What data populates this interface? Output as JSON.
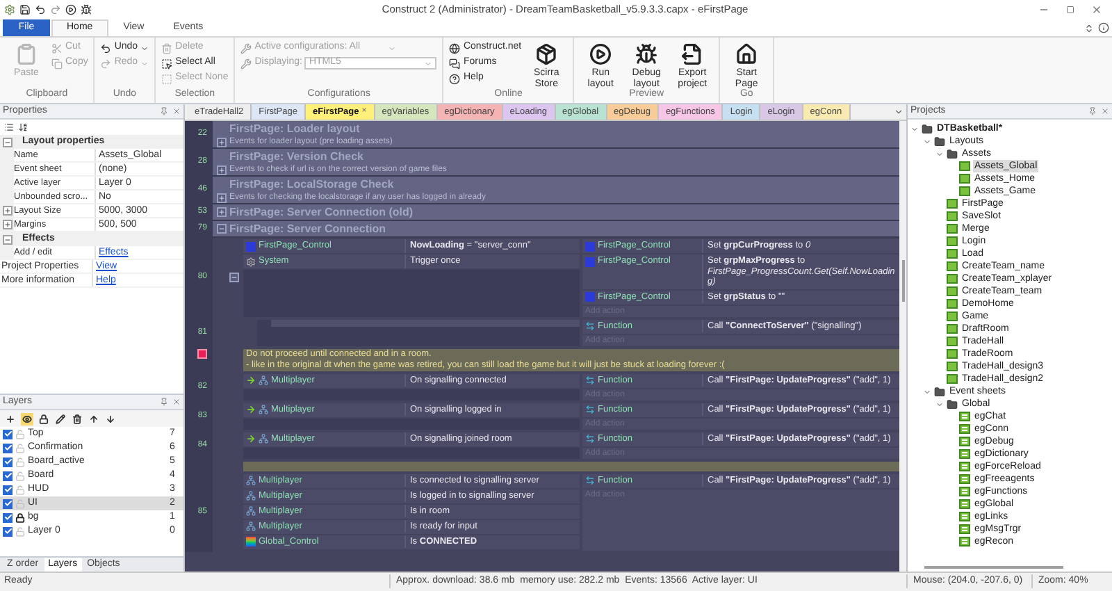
{
  "title_bar": {
    "title": "Construct 2 (Administrator) - DreamTeamBasketball_v5.9.3.3.capx - eFirstPage"
  },
  "ribbon_tabs": [
    {
      "label": "File",
      "kind": "file",
      "selected": false
    },
    {
      "label": "Home",
      "kind": "tab",
      "selected": true
    },
    {
      "label": "View",
      "kind": "tab",
      "selected": false
    },
    {
      "label": "Events",
      "kind": "tab",
      "selected": false
    }
  ],
  "ribbon_groups": [
    {
      "label": "Clipboard",
      "items": [
        {
          "kind": "large",
          "label": "Paste",
          "disabled": true
        },
        {
          "kind": "small",
          "label": "Cut",
          "disabled": true
        },
        {
          "kind": "small",
          "label": "Copy",
          "disabled": true
        }
      ]
    },
    {
      "label": "Undo",
      "items": [
        {
          "kind": "menu",
          "label": "Undo",
          "disabled": false
        },
        {
          "kind": "menu",
          "label": "Redo",
          "disabled": true
        }
      ]
    },
    {
      "label": "Selection",
      "items": [
        {
          "kind": "small",
          "label": "Delete",
          "disabled": true
        },
        {
          "kind": "small",
          "label": "Select All",
          "disabled": false
        },
        {
          "kind": "small",
          "label": "Select None",
          "disabled": true
        }
      ]
    },
    {
      "label": "Configurations",
      "items": [
        {
          "kind": "combo",
          "label": "Active configurations: All",
          "disabled": true
        },
        {
          "kind": "select",
          "label": "Displaying:",
          "value": "HTML5",
          "disabled": true
        }
      ]
    },
    {
      "label": "Online",
      "items": [
        {
          "kind": "small",
          "label": "Construct.net",
          "disabled": false
        },
        {
          "kind": "small",
          "label": "Forums",
          "disabled": false
        },
        {
          "kind": "small",
          "label": "Help",
          "disabled": false
        },
        {
          "kind": "large",
          "label": "Scirra Store",
          "disabled": false
        }
      ]
    },
    {
      "label": "Preview",
      "items": [
        {
          "kind": "large",
          "label": "Run layout",
          "disabled": false
        },
        {
          "kind": "large",
          "label": "Debug layout",
          "disabled": false
        },
        {
          "kind": "large",
          "label": "Export project",
          "disabled": false
        }
      ]
    },
    {
      "label": "Go",
      "items": [
        {
          "kind": "large",
          "label": "Start Page",
          "disabled": false
        }
      ]
    }
  ],
  "properties": {
    "title": "Properties",
    "sections": [
      {
        "title": "Layout properties",
        "expanded": true,
        "rows": [
          {
            "name": "Name",
            "value": "Assets_Global",
            "expandable": false,
            "link": false
          },
          {
            "name": "Event sheet",
            "value": "(none)",
            "expandable": false,
            "link": false
          },
          {
            "name": "Active layer",
            "value": "Layer 0",
            "expandable": false,
            "link": false
          },
          {
            "name": "Unbounded scro...",
            "value": "No",
            "expandable": false,
            "link": false
          },
          {
            "name": "Layout Size",
            "value": "5000, 3000",
            "expandable": true,
            "link": false
          },
          {
            "name": "Margins",
            "value": "500, 500",
            "expandable": true,
            "link": false
          }
        ]
      },
      {
        "title": "Effects",
        "expanded": true,
        "rows": [
          {
            "name": "Add / edit",
            "value": "Effects",
            "expandable": false,
            "link": true
          }
        ]
      }
    ],
    "rows": [
      {
        "name": "Project Properties",
        "value": "View",
        "link": true
      },
      {
        "name": "More information",
        "value": "Help",
        "link": true
      }
    ]
  },
  "layers": {
    "title": "Layers",
    "eye_tool_on": true,
    "items": [
      {
        "name": "Top",
        "number": "7",
        "visible": true,
        "locked": false,
        "selected": false
      },
      {
        "name": "Confirmation",
        "number": "6",
        "visible": true,
        "locked": false,
        "selected": false
      },
      {
        "name": "Board_active",
        "number": "5",
        "visible": true,
        "locked": false,
        "selected": false
      },
      {
        "name": "Board",
        "number": "4",
        "visible": true,
        "locked": false,
        "selected": false
      },
      {
        "name": "HUD",
        "number": "3",
        "visible": true,
        "locked": false,
        "selected": false
      },
      {
        "name": "UI",
        "number": "2",
        "visible": true,
        "locked": false,
        "selected": true
      },
      {
        "name": "bg",
        "number": "1",
        "visible": true,
        "locked": true,
        "selected": false
      },
      {
        "name": "Layer 0",
        "number": "0",
        "visible": true,
        "locked": false,
        "selected": false
      }
    ],
    "tabs": [
      {
        "label": "Z order",
        "selected": false
      },
      {
        "label": "Layers",
        "selected": true
      },
      {
        "label": "Objects",
        "selected": false
      }
    ]
  },
  "sheet_tabs": [
    {
      "label": "eTradeHall2",
      "color": "#eeeeee",
      "selected": false
    },
    {
      "label": "FirstPage",
      "color": "#dde6f4",
      "selected": false
    },
    {
      "label": "eFirstPage",
      "color": "#fff07a",
      "selected": true,
      "close": "×"
    },
    {
      "label": "egVariables",
      "color": "#d6e6bc",
      "selected": false
    },
    {
      "label": "egDictionary",
      "color": "#f4b4b4",
      "selected": false
    },
    {
      "label": "eLoading",
      "color": "#dcc6f0",
      "selected": false
    },
    {
      "label": "egGlobal",
      "color": "#b8e2d2",
      "selected": false
    },
    {
      "label": "egDebug",
      "color": "#f8cc98",
      "selected": false
    },
    {
      "label": "egFunctions",
      "color": "#f6c6e6",
      "selected": false
    },
    {
      "label": "Login",
      "color": "#c6e0f2",
      "selected": false
    },
    {
      "label": "eLogin",
      "color": "#d8c8e6",
      "selected": false
    },
    {
      "label": "egConn",
      "color": "#f8eab0",
      "selected": false
    }
  ],
  "events": [
    {
      "kind": "group",
      "number": "22",
      "title": "FirstPage: Loader layout",
      "description": "Events for loader layout (pre loading assets)",
      "expanded": false
    },
    {
      "kind": "group",
      "number": "28",
      "title": "FirstPage: Version Check",
      "description": "Events to check if url is on the correct version of game files",
      "expanded": false
    },
    {
      "kind": "group",
      "number": "46",
      "title": "FirstPage: LocalStorage Check",
      "description": "Events for checking the localstorage if any user has logged in already",
      "expanded": false
    },
    {
      "kind": "group",
      "number": "53",
      "title": "FirstPage: Server Connection (old)",
      "expanded": false
    },
    {
      "kind": "group",
      "number": "79",
      "title": "FirstPage: Server Connection",
      "expanded": true,
      "children": [
        {
          "kind": "event",
          "number": "80",
          "trigger": false,
          "expanded": true,
          "conditions": [
            {
              "kind": "sprite",
              "object": "FirstPage_Control",
              "text": "**NowLoading** = \"server_conn\""
            },
            {
              "kind": "system",
              "object": "System",
              "text": "Trigger once"
            }
          ],
          "actions": [
            {
              "kind": "sprite",
              "object": "FirstPage_Control",
              "text": "Set **grpCurProgress** to *0*"
            },
            {
              "kind": "sprite",
              "object": "FirstPage_Control",
              "text": "Set **grpMaxProgress** to *FirstPage_ProgressCount.Get(Self.NowLoading)*"
            },
            {
              "kind": "sprite",
              "object": "FirstPage_Control",
              "text": "Set **grpStatus** to \"\""
            }
          ],
          "add_action": "Add action",
          "children": [
            {
              "kind": "event",
              "number": "81",
              "actions": [
                {
                  "kind": "function",
                  "object": "Function",
                  "text": "Call **\"ConnectToServer\"** (\"signalling\")"
                }
              ],
              "add_action": "Add action"
            }
          ]
        },
        {
          "kind": "comment",
          "text": "Do not proceed until connected and in a room.\n- like in the original dt when the game was retired, you can still load the game but it will just be stuck at loading forever :("
        },
        {
          "kind": "event",
          "number": "82",
          "trigger": true,
          "conditions": [
            {
              "kind": "multiplayer",
              "object": "Multiplayer",
              "text": "On signalling connected"
            }
          ],
          "actions": [
            {
              "kind": "function",
              "object": "Function",
              "text": "Call **\"FirstPage: UpdateProgress\"** (\"add\", 1)"
            }
          ],
          "add_action": "Add action"
        },
        {
          "kind": "event",
          "number": "83",
          "trigger": true,
          "conditions": [
            {
              "kind": "multiplayer",
              "object": "Multiplayer",
              "text": "On signalling logged in"
            }
          ],
          "actions": [
            {
              "kind": "function",
              "object": "Function",
              "text": "Call **\"FirstPage: UpdateProgress\"** (\"add\", 1)"
            }
          ],
          "add_action": "Add action"
        },
        {
          "kind": "event",
          "number": "84",
          "trigger": true,
          "conditions": [
            {
              "kind": "multiplayer",
              "object": "Multiplayer",
              "text": "On signalling joined room"
            }
          ],
          "actions": [
            {
              "kind": "function",
              "object": "Function",
              "text": "Call **\"FirstPage: UpdateProgress\"** (\"add\", 1)"
            }
          ],
          "add_action": "Add action"
        },
        {
          "kind": "comment"
        },
        {
          "kind": "event",
          "number": "85",
          "trigger": false,
          "conditions": [
            {
              "kind": "multiplayer",
              "object": "Multiplayer",
              "text": "Is connected to signalling server"
            },
            {
              "kind": "multiplayer",
              "object": "Multiplayer",
              "text": "Is logged in to signalling server"
            },
            {
              "kind": "multiplayer",
              "object": "Multiplayer",
              "text": "Is in room"
            },
            {
              "kind": "multiplayer",
              "object": "Multiplayer",
              "text": "Is ready for input"
            },
            {
              "kind": "rainbow",
              "object": "Global_Control",
              "text": "Is **CONNECTED**"
            }
          ],
          "actions": [
            {
              "kind": "function",
              "object": "Function",
              "text": "Call **\"FirstPage: UpdateProgress\"** (\"add\", 1)"
            }
          ],
          "add_action": "Add action"
        }
      ]
    }
  ],
  "projects": {
    "title": "Projects",
    "tree": [
      {
        "kind": "project",
        "label": "DTBasketball*",
        "expanded": true,
        "children": [
          {
            "kind": "folder",
            "label": "Layouts",
            "expanded": true,
            "children": [
              {
                "kind": "folder",
                "label": "Assets",
                "expanded": true,
                "children": [
                  {
                    "kind": "layout",
                    "label": "Assets_Global",
                    "selected": true
                  },
                  {
                    "kind": "layout",
                    "label": "Assets_Home",
                    "selected": false
                  },
                  {
                    "kind": "layout",
                    "label": "Assets_Game",
                    "selected": false
                  }
                ]
              },
              {
                "kind": "layout",
                "label": "FirstPage",
                "selected": false
              },
              {
                "kind": "layout",
                "label": "SaveSlot",
                "selected": false
              },
              {
                "kind": "layout",
                "label": "Merge",
                "selected": false
              },
              {
                "kind": "layout",
                "label": "Login",
                "selected": false
              },
              {
                "kind": "layout",
                "label": "Load",
                "selected": false
              },
              {
                "kind": "layout",
                "label": "CreateTeam_name",
                "selected": false
              },
              {
                "kind": "layout",
                "label": "CreateTeam_xplayer",
                "selected": false
              },
              {
                "kind": "layout",
                "label": "CreateTeam_team",
                "selected": false
              },
              {
                "kind": "layout",
                "label": "DemoHome",
                "selected": false
              },
              {
                "kind": "layout",
                "label": "Game",
                "selected": false
              },
              {
                "kind": "layout",
                "label": "DraftRoom",
                "selected": false
              },
              {
                "kind": "layout",
                "label": "TradeHall",
                "selected": false
              },
              {
                "kind": "layout",
                "label": "TradeRoom",
                "selected": false
              },
              {
                "kind": "layout",
                "label": "TradeHall_design3",
                "selected": false
              },
              {
                "kind": "layout",
                "label": "TradeHall_design2",
                "selected": false
              }
            ]
          },
          {
            "kind": "folder",
            "label": "Event sheets",
            "expanded": true,
            "children": [
              {
                "kind": "folder",
                "label": "Global",
                "expanded": true,
                "children": [
                  {
                    "kind": "sheet",
                    "label": "egChat",
                    "selected": false
                  },
                  {
                    "kind": "sheet",
                    "label": "egConn",
                    "selected": false
                  },
                  {
                    "kind": "sheet",
                    "label": "egDebug",
                    "selected": false
                  },
                  {
                    "kind": "sheet",
                    "label": "egDictionary",
                    "selected": false
                  },
                  {
                    "kind": "sheet",
                    "label": "egForceReload",
                    "selected": false
                  },
                  {
                    "kind": "sheet",
                    "label": "egFreeagents",
                    "selected": false
                  },
                  {
                    "kind": "sheet",
                    "label": "egFunctions",
                    "selected": false
                  },
                  {
                    "kind": "sheet",
                    "label": "egGlobal",
                    "selected": false
                  },
                  {
                    "kind": "sheet",
                    "label": "egLinks",
                    "selected": false
                  },
                  {
                    "kind": "sheet",
                    "label": "egMsgTrgr",
                    "selected": false
                  },
                  {
                    "kind": "sheet",
                    "label": "egRecon",
                    "selected": false
                  }
                ]
              }
            ]
          }
        ]
      }
    ]
  },
  "status_bar": {
    "left": "Ready",
    "stats": "Approx. download: 38.6 mb  memory use: 282.2 mb  Events: 13566  Active layer: UI",
    "mouse": "Mouse: (204.0, -207.6, 0)",
    "zoom": "Zoom: 40%"
  }
}
